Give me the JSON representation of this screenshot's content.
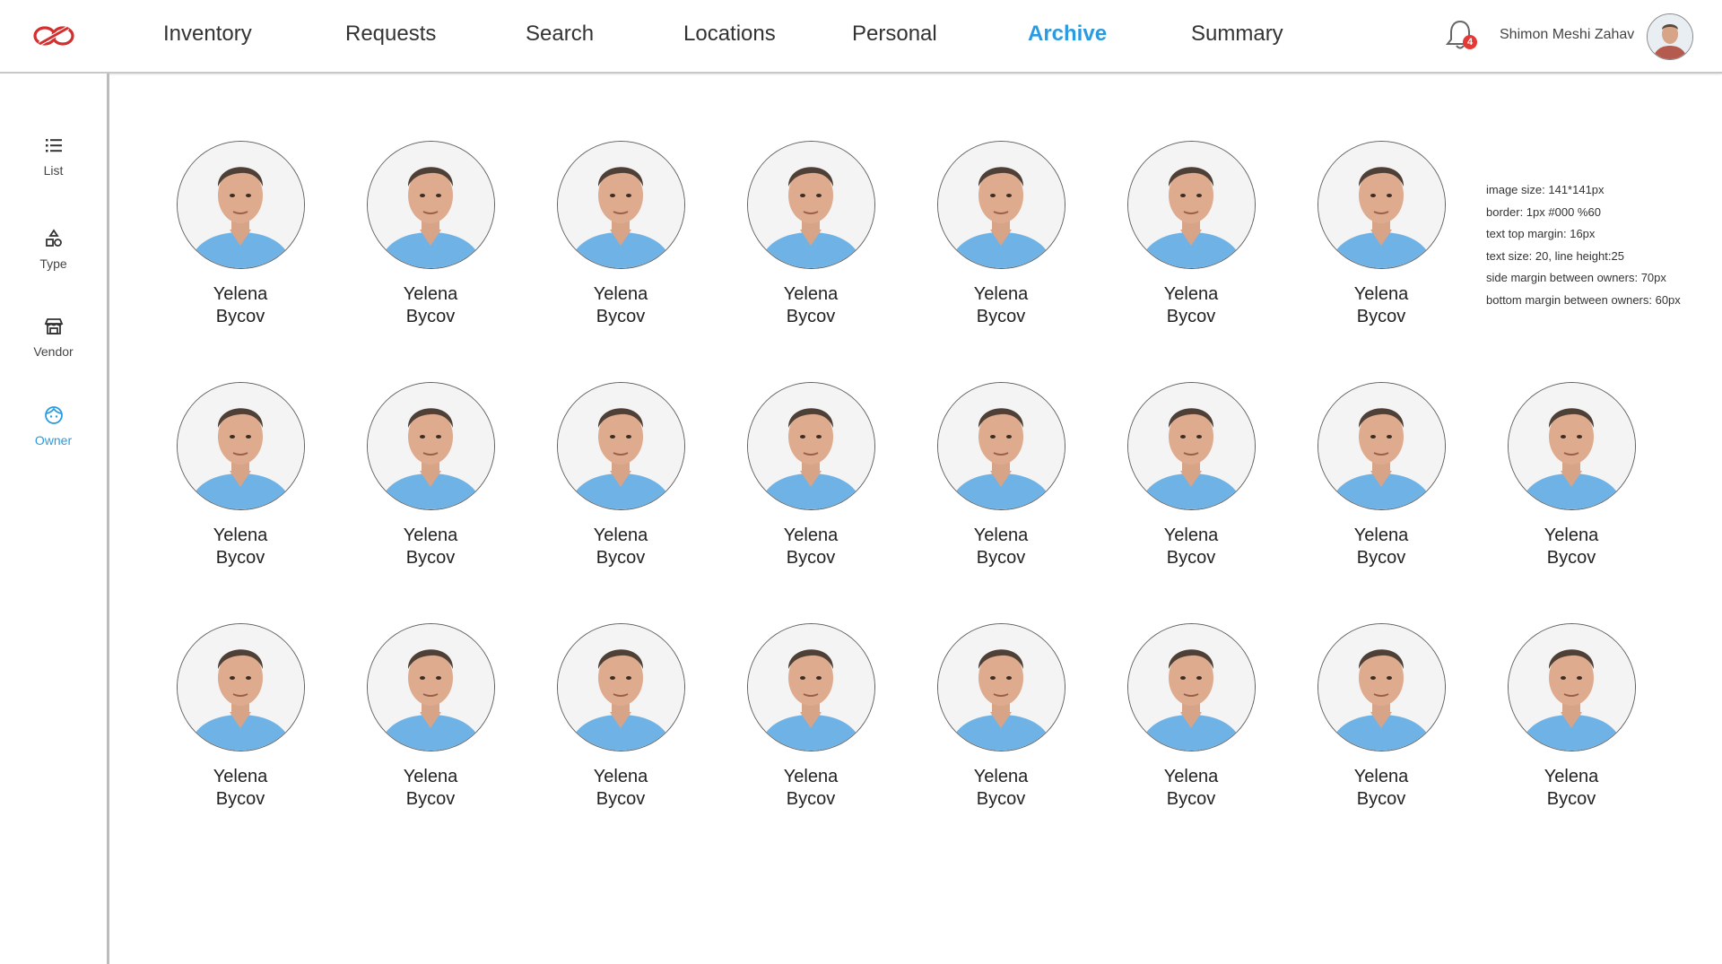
{
  "nav": {
    "items": [
      {
        "label": "Inventory"
      },
      {
        "label": "Requests"
      },
      {
        "label": "Search"
      },
      {
        "label": "Locations"
      },
      {
        "label": "Personal"
      },
      {
        "label": "Archive"
      },
      {
        "label": "Summary"
      }
    ],
    "active": "Archive"
  },
  "user": {
    "name": "Shimon Meshi Zahav",
    "notifications": "4"
  },
  "sidebar": {
    "items": [
      {
        "label": "List",
        "icon": "list-icon"
      },
      {
        "label": "Type",
        "icon": "shapes-icon"
      },
      {
        "label": "Vendor",
        "icon": "store-icon"
      },
      {
        "label": "Owner",
        "icon": "face-icon"
      }
    ],
    "active": "Owner"
  },
  "owners": [
    {
      "first": "Yelena",
      "last": "Bycov"
    },
    {
      "first": "Yelena",
      "last": "Bycov"
    },
    {
      "first": "Yelena",
      "last": "Bycov"
    },
    {
      "first": "Yelena",
      "last": "Bycov"
    },
    {
      "first": "Yelena",
      "last": "Bycov"
    },
    {
      "first": "Yelena",
      "last": "Bycov"
    },
    {
      "first": "Yelena",
      "last": "Bycov"
    },
    {
      "first": "Yelena",
      "last": "Bycov"
    },
    {
      "first": "Yelena",
      "last": "Bycov"
    },
    {
      "first": "Yelena",
      "last": "Bycov"
    },
    {
      "first": "Yelena",
      "last": "Bycov"
    },
    {
      "first": "Yelena",
      "last": "Bycov"
    },
    {
      "first": "Yelena",
      "last": "Bycov"
    },
    {
      "first": "Yelena",
      "last": "Bycov"
    },
    {
      "first": "Yelena",
      "last": "Bycov"
    },
    {
      "first": "Yelena",
      "last": "Bycov"
    },
    {
      "first": "Yelena",
      "last": "Bycov"
    },
    {
      "first": "Yelena",
      "last": "Bycov"
    },
    {
      "first": "Yelena",
      "last": "Bycov"
    },
    {
      "first": "Yelena",
      "last": "Bycov"
    },
    {
      "first": "Yelena",
      "last": "Bycov"
    },
    {
      "first": "Yelena",
      "last": "Bycov"
    },
    {
      "first": "Yelena",
      "last": "Bycov"
    }
  ],
  "notes": [
    "image size: 141*141px",
    "border: 1px #000 %60",
    "text top margin: 16px",
    "text size: 20,  line height:25",
    "side margin between owners: 70px",
    "bottom margin between owners: 60px"
  ],
  "colors": {
    "accent": "#2a9be0",
    "logo": "#d32f2f",
    "badge": "#e53935"
  }
}
